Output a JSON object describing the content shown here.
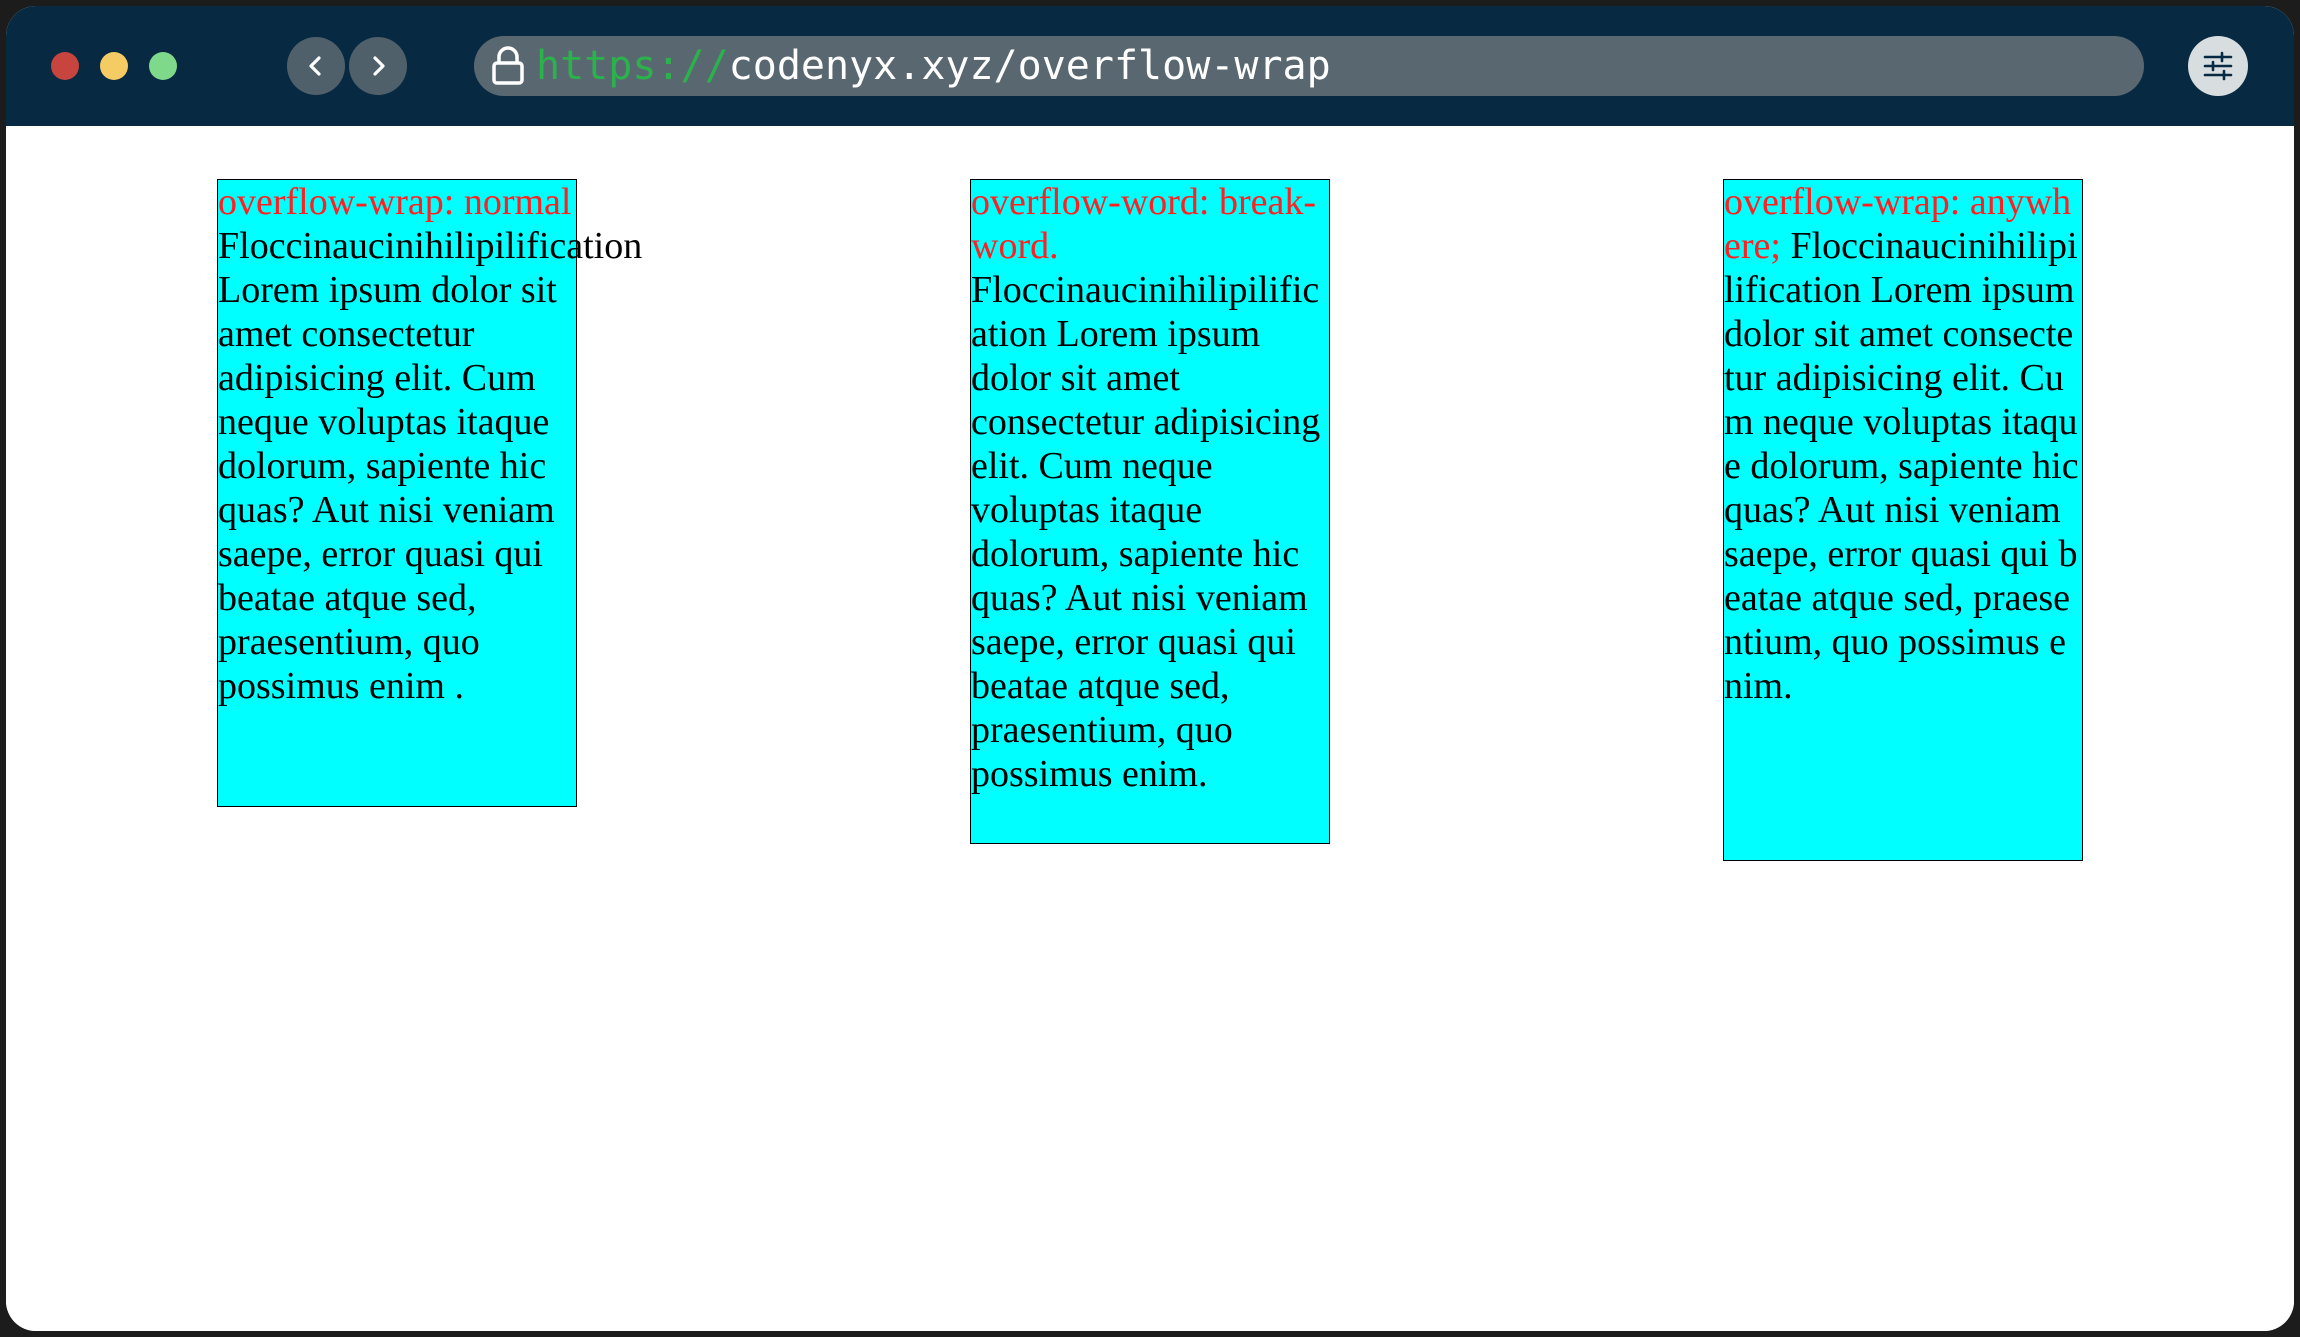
{
  "browser": {
    "url_scheme": "https://",
    "url_rest": "codenyx.xyz/overflow-wrap",
    "icons": {
      "back": "chevron-left-icon",
      "forward": "chevron-right-icon",
      "lock": "lock-icon",
      "menu": "sliders-icon"
    },
    "colors": {
      "titlebar": "#072a42",
      "urlbar": "#596870",
      "scheme": "#2bb24c",
      "red_light": "#c8453f",
      "yellow_light": "#f5cb63",
      "green_light": "#7fd98a"
    }
  },
  "demos": [
    {
      "heading": "overflow-wrap: normal",
      "long_word": "Floccinaucinihilipilification",
      "body": "Lorem ipsum dolor sit amet consectetur adipisicing elit. Cum neque voluptas itaque dolorum, sapiente hic quas? Aut nisi veniam saepe, error quasi qui beatae atque sed, praesentium, quo possimus enim ."
    },
    {
      "heading": "overflow-word: break-word.",
      "long_word": "Floccinaucinihilipilification",
      "body": "Lorem ipsum dolor sit amet consectetur adipisicing elit. Cum neque voluptas itaque dolorum, sapiente hic quas? Aut nisi veniam saepe, error quasi qui beatae atque sed, praesentium, quo possimus enim."
    },
    {
      "heading": "overflow-wrap: anywhere;",
      "long_word": "Floccinaucinihilipilification",
      "body": "Lorem ipsum dolor sit amet consectetur adipisicing elit. Cum neque voluptas itaque dolorum, sapiente hic quas? Aut nisi veniam saepe, error quasi qui beatae atque sed, praesentium, quo possimus enim."
    }
  ],
  "colors": {
    "box_bg": "#00ffff",
    "heading": "#ff2020"
  }
}
